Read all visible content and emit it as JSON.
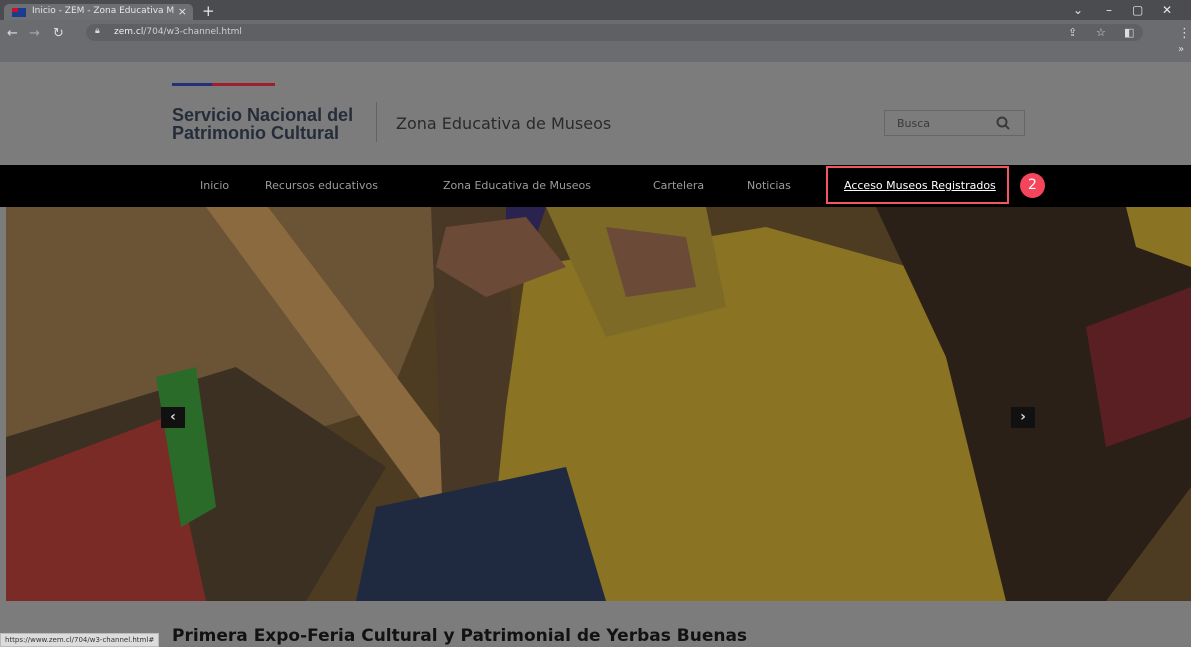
{
  "browser": {
    "tab_title": "Inicio - ZEM - Zona Educativa Museos",
    "tab_close": "×",
    "new_tab": "+",
    "url_host": "zem.cl",
    "url_path": "/704/w3-channel.html",
    "window_controls": {
      "dropdown": "⌄",
      "minimize": "–",
      "restore": "▢",
      "close": "✕"
    }
  },
  "header": {
    "logo_line1": "Servicio Nacional del",
    "logo_line2": "Patrimonio Cultural",
    "site_name": "Zona Educativa de Museos",
    "search_placeholder": "Busca"
  },
  "nav": {
    "items": [
      {
        "label": "Inicio"
      },
      {
        "label": "Recursos educativos"
      },
      {
        "label": "Zona Educativa de Museos"
      },
      {
        "label": "Cartelera"
      },
      {
        "label": "Noticias"
      },
      {
        "label": "Acceso Museos Registrados",
        "active": true
      }
    ]
  },
  "annotation": {
    "step": "2",
    "color": "#f5455a"
  },
  "carousel": {
    "prev": "‹",
    "next": "›"
  },
  "article": {
    "title": "Primera Expo-Feria Cultural y Patrimonial de Yerbas Buenas"
  },
  "status_bar": {
    "url": "https://www.zem.cl/704/w3-channel.html#"
  },
  "icons": [
    "back-icon",
    "forward-icon",
    "reload-icon",
    "lock-icon",
    "share-icon",
    "star-icon",
    "sidebar-icon",
    "menu-icon",
    "search-icon",
    "chevron-left-icon",
    "chevron-right-icon"
  ]
}
